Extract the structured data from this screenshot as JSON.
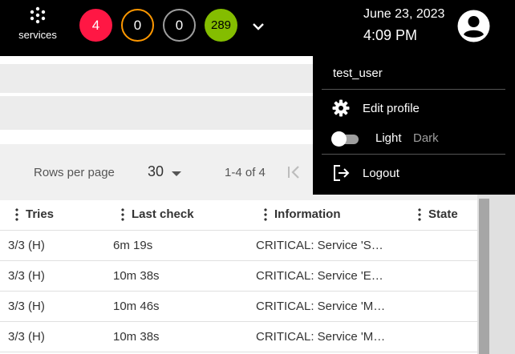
{
  "header": {
    "services_label": "services",
    "counters": {
      "critical": "4",
      "warning": "0",
      "unknown": "0",
      "ok": "289"
    },
    "date": "June 23, 2023",
    "time": "4:09 PM"
  },
  "colors": {
    "critical": "#ff1744",
    "warning": "#ff9800",
    "unknown": "#9e9e9e",
    "ok": "#84bd00"
  },
  "pagination": {
    "rows_per_page_label": "Rows per page",
    "rows_per_page_value": "30",
    "range": "1-4 of 4"
  },
  "table": {
    "columns": [
      "Tries",
      "Last check",
      "Information",
      "State"
    ],
    "rows": [
      {
        "tries": "3/3 (H)",
        "last_check": "6m 19s",
        "information": "CRITICAL: Service 'S…"
      },
      {
        "tries": "3/3 (H)",
        "last_check": "10m 38s",
        "information": "CRITICAL: Service 'E…"
      },
      {
        "tries": "3/3 (H)",
        "last_check": "10m 46s",
        "information": "CRITICAL: Service 'M…"
      },
      {
        "tries": "3/3 (H)",
        "last_check": "10m 38s",
        "information": "CRITICAL: Service 'M…"
      }
    ]
  },
  "user_menu": {
    "username": "test_user",
    "edit_profile": "Edit profile",
    "theme_light": "Light",
    "theme_dark": "Dark",
    "logout": "Logout"
  },
  "icons": [
    "services-icon",
    "chevron-down-icon",
    "account-circle-icon",
    "first-page-icon",
    "gear-icon",
    "logout-icon",
    "column-menu-icon"
  ]
}
